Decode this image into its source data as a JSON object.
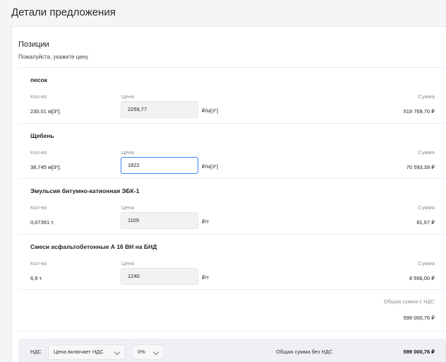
{
  "page": {
    "title": "Детали предложения"
  },
  "section": {
    "title": "Позиции",
    "subtitle": "Пожалуйста, укажите цену"
  },
  "labels": {
    "qty": "Кол-во",
    "price": "Цена",
    "sum": "Сумма"
  },
  "items": [
    {
      "name": "песок",
      "qty": "230,01 м[3*].",
      "price": "2259,77",
      "unit": "₽/м[3*]",
      "sum": "519 769,70 ₽"
    },
    {
      "name": "Щебень",
      "qty": "38,745 м[3*].",
      "price": "1822",
      "unit": "₽/м[3*]",
      "sum": "70 593,39 ₽"
    },
    {
      "name": "Эмульсия битумно-катионная ЭБК-1",
      "qty": "0,07391 т.",
      "price": "1105",
      "unit": "₽/т",
      "sum": "81,67 ₽"
    },
    {
      "name": "Смеси асфальтобетонные А 16 ВН на БНД",
      "qty": "6,9 т.",
      "price": "1240",
      "unit": "₽/т",
      "sum": "8 556,00 ₽"
    }
  ],
  "totals": {
    "with_vat_label": "Общая сумма с НДС",
    "with_vat_value": "599 000,76 ₽"
  },
  "footer": {
    "vat_label": "НДС",
    "vat_mode": "Цена включает НДС",
    "vat_rate": "0%",
    "net_label": "Общая сумма без НДС",
    "net_value": "599 000,76 ₽"
  },
  "colors": {
    "accent": "#3b82f6",
    "page_bg": "#f4f5f7",
    "input_bg": "#f1f2f4",
    "footer_bg": "#eef0f3"
  }
}
